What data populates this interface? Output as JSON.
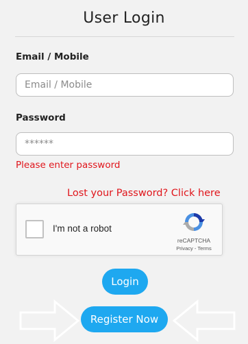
{
  "title": "User Login",
  "email": {
    "label": "Email / Mobile",
    "placeholder": "Email / Mobile",
    "value": ""
  },
  "password": {
    "label": "Password",
    "placeholder": "******",
    "value": "",
    "error": "Please enter password"
  },
  "forgot_link": "Lost your Password? Click here",
  "recaptcha": {
    "checkbox_label": "I'm not a robot",
    "brand": "reCAPTCHA",
    "links": "Privacy - Terms",
    "icon": "recaptcha-logo-icon"
  },
  "buttons": {
    "login": "Login",
    "register": "Register Now"
  },
  "colors": {
    "primary_button": "#1ea8f0",
    "error_text": "#e0151b"
  }
}
